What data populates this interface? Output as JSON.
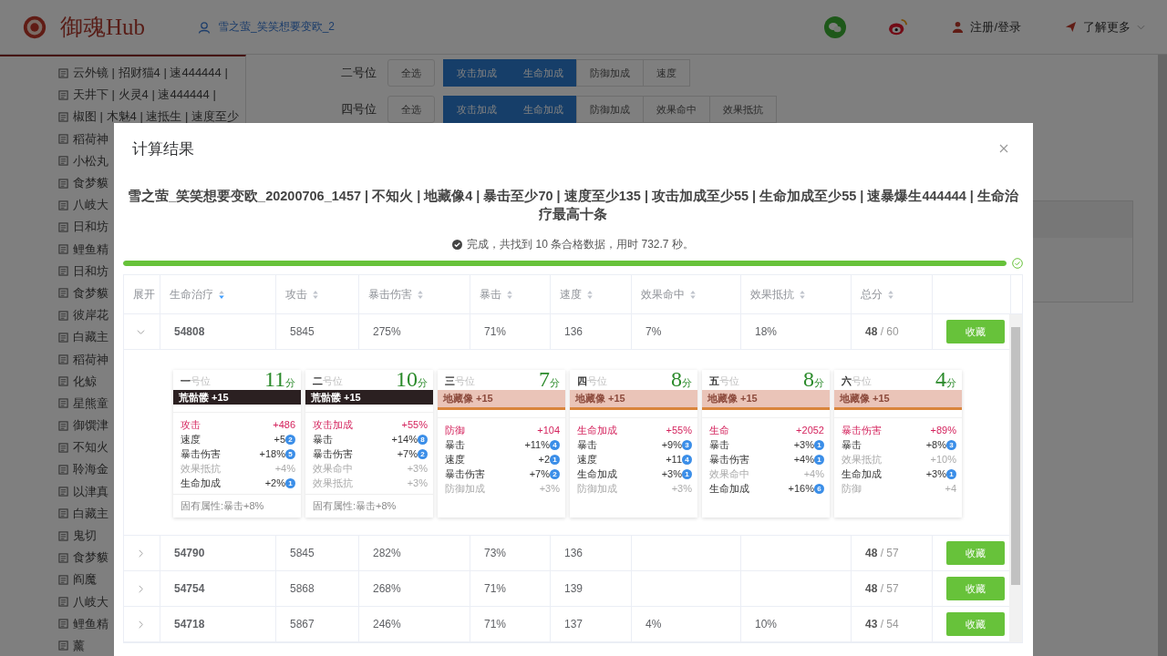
{
  "header": {
    "title": "御魂Hub",
    "user": "雪之萤_笑笑想要变欧_2",
    "login": "注册/登录",
    "more": "了解更多"
  },
  "sidebar": {
    "items": [
      {
        "label": "云外镜 | 招财猫4 | 速444444 |"
      },
      {
        "label": "天井下 | 火灵4 | 速444444 |"
      },
      {
        "label": "椒图 | 木魅4 | 速抵生 | 速度至少"
      },
      {
        "label": "稻荷神"
      },
      {
        "label": "小松丸"
      },
      {
        "label": "食梦貘"
      },
      {
        "label": "八岐大"
      },
      {
        "label": "日和坊"
      },
      {
        "label": "鲤鱼精"
      },
      {
        "label": "日和坊"
      },
      {
        "label": "食梦貘"
      },
      {
        "label": "彼岸花"
      },
      {
        "label": "白藏主"
      },
      {
        "label": "稻荷神"
      },
      {
        "label": "化鲸"
      },
      {
        "label": "星熊童"
      },
      {
        "label": "御馔津"
      },
      {
        "label": "不知火"
      },
      {
        "label": "聆海金"
      },
      {
        "label": "以津真"
      },
      {
        "label": "白藏主"
      },
      {
        "label": "鬼切"
      },
      {
        "label": "食梦貘"
      },
      {
        "label": "阎魔"
      },
      {
        "label": "八岐大"
      },
      {
        "label": "鲤鱼精"
      },
      {
        "label": "薰"
      }
    ]
  },
  "filters": [
    {
      "label": "二号位",
      "select_all": "全选",
      "options": [
        {
          "label": "攻击加成",
          "selected": true
        },
        {
          "label": "生命加成",
          "selected": true
        },
        {
          "label": "防御加成",
          "selected": false
        },
        {
          "label": "速度",
          "selected": false
        }
      ]
    },
    {
      "label": "四号位",
      "select_all": "全选",
      "options": [
        {
          "label": "攻击加成",
          "selected": true
        },
        {
          "label": "生命加成",
          "selected": true
        },
        {
          "label": "防御加成",
          "selected": false
        },
        {
          "label": "效果命中",
          "selected": false
        },
        {
          "label": "效果抵抗",
          "selected": false
        }
      ]
    }
  ],
  "modal": {
    "title": "计算结果",
    "heading": "雪之萤_笑笑想要变欧_20200706_1457 | 不知火 | 地藏像4 | 暴击至少70 | 速度至少135 | 攻击加成至少55 | 生命加成至少55 | 速暴爆生444444 | 生命治疗最高十条",
    "status": "完成，共找到 10 条合格数据，用时 732.7 秒。",
    "progress": {
      "level": 1
    },
    "expand_header": "展开",
    "columns": [
      {
        "label": "生命治疗",
        "sorted": true
      },
      {
        "label": "攻击",
        "sorted": false
      },
      {
        "label": "暴击伤害",
        "sorted": false
      },
      {
        "label": "暴击",
        "sorted": false
      },
      {
        "label": "速度",
        "sorted": false
      },
      {
        "label": "效果命中",
        "sorted": false
      },
      {
        "label": "效果抵抗",
        "sorted": false
      },
      {
        "label": "总分",
        "sorted": false
      }
    ],
    "rows": [
      {
        "expanded": true,
        "cells": [
          "54808",
          "5845",
          "275%",
          "71%",
          "136",
          "7%",
          "18%"
        ],
        "score": "**48** / 60",
        "action": "收藏",
        "cards": [
          {
            "num": "一",
            "suffix": "号位",
            "score": "11",
            "unit": "分",
            "set": {
              "label": "荒骷髅 +15",
              "kind": "dark"
            },
            "main": {
              "name": "攻击",
              "value": "+486"
            },
            "subs": [
              {
                "name": "速度",
                "value": "+5",
                "counted": true,
                "upgrades": "2"
              },
              {
                "name": "暴击伤害",
                "value": "+18%",
                "counted": true,
                "upgrades": "5"
              },
              {
                "name": "效果抵抗",
                "value": "+4%",
                "counted": false
              },
              {
                "name": "生命加成",
                "value": "+2%",
                "counted": true,
                "upgrades": "1"
              }
            ],
            "footer": "固有属性:暴击+8%"
          },
          {
            "num": "二",
            "suffix": "号位",
            "score": "10",
            "unit": "分",
            "set": {
              "label": "荒骷髅 +15",
              "kind": "dark"
            },
            "main": {
              "name": "攻击加成",
              "value": "+55%"
            },
            "subs": [
              {
                "name": "暴击",
                "value": "+14%",
                "counted": true,
                "upgrades": "8"
              },
              {
                "name": "暴击伤害",
                "value": "+7%",
                "counted": true,
                "upgrades": "2"
              },
              {
                "name": "效果命中",
                "value": "+3%",
                "counted": false
              },
              {
                "name": "效果抵抗",
                "value": "+3%",
                "counted": false
              }
            ],
            "footer": "固有属性:暴击+8%"
          },
          {
            "num": "三",
            "suffix": "号位",
            "score": "7",
            "unit": "分",
            "set": {
              "label": "地藏像 +15",
              "kind": "light"
            },
            "main": {
              "name": "防御",
              "value": "+104"
            },
            "subs": [
              {
                "name": "暴击",
                "value": "+11%",
                "counted": true,
                "upgrades": "4"
              },
              {
                "name": "速度",
                "value": "+2",
                "counted": true,
                "upgrades": "1"
              },
              {
                "name": "暴击伤害",
                "value": "+7%",
                "counted": true,
                "upgrades": "2"
              },
              {
                "name": "防御加成",
                "value": "+3%",
                "counted": false
              }
            ]
          },
          {
            "num": "四",
            "suffix": "号位",
            "score": "8",
            "unit": "分",
            "set": {
              "label": "地藏像 +15",
              "kind": "light"
            },
            "main": {
              "name": "生命加成",
              "value": "+55%"
            },
            "subs": [
              {
                "name": "暴击",
                "value": "+9%",
                "counted": true,
                "upgrades": "3"
              },
              {
                "name": "速度",
                "value": "+11",
                "counted": true,
                "upgrades": "4"
              },
              {
                "name": "生命加成",
                "value": "+3%",
                "counted": true,
                "upgrades": "1"
              },
              {
                "name": "防御加成",
                "value": "+3%",
                "counted": false
              }
            ]
          },
          {
            "num": "五",
            "suffix": "号位",
            "score": "8",
            "unit": "分",
            "set": {
              "label": "地藏像 +15",
              "kind": "light"
            },
            "main": {
              "name": "生命",
              "value": "+2052"
            },
            "subs": [
              {
                "name": "暴击",
                "value": "+3%",
                "counted": true,
                "upgrades": "1"
              },
              {
                "name": "暴击伤害",
                "value": "+4%",
                "counted": true,
                "upgrades": "1"
              },
              {
                "name": "效果命中",
                "value": "+4%",
                "counted": false
              },
              {
                "name": "生命加成",
                "value": "+16%",
                "counted": true,
                "upgrades": "6"
              }
            ]
          },
          {
            "num": "六",
            "suffix": "号位",
            "score": "4",
            "unit": "分",
            "set": {
              "label": "地藏像 +15",
              "kind": "light"
            },
            "main": {
              "name": "暴击伤害",
              "value": "+89%"
            },
            "subs": [
              {
                "name": "暴击",
                "value": "+8%",
                "counted": true,
                "upgrades": "3"
              },
              {
                "name": "效果抵抗",
                "value": "+10%",
                "counted": false
              },
              {
                "name": "生命加成",
                "value": "+3%",
                "counted": true,
                "upgrades": "1"
              },
              {
                "name": "防御",
                "value": "+4",
                "counted": false
              }
            ]
          }
        ]
      },
      {
        "expanded": false,
        "cells": [
          "54790",
          "5845",
          "282%",
          "73%",
          "136",
          null,
          null
        ],
        "score": "**48** / 57",
        "action": "收藏"
      },
      {
        "expanded": false,
        "cells": [
          "54754",
          "5868",
          "268%",
          "71%",
          "139",
          null,
          null
        ],
        "score": "**48** / 57",
        "action": "收藏"
      },
      {
        "expanded": false,
        "cells": [
          "54718",
          "5867",
          "246%",
          "71%",
          "137",
          "4%",
          "10%"
        ],
        "score": "**43** / 54",
        "action": "收藏"
      }
    ]
  }
}
